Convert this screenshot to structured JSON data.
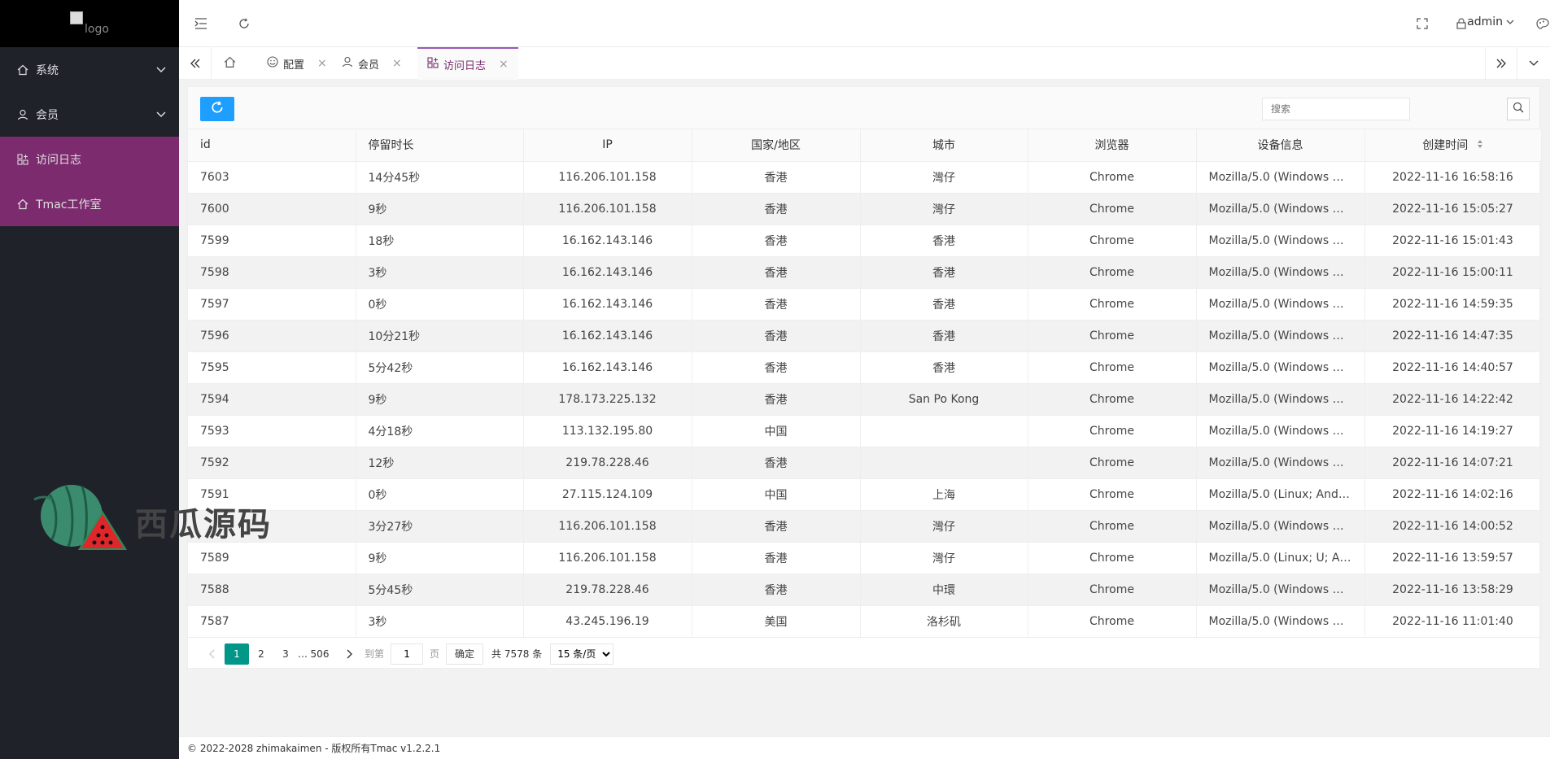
{
  "logo": {
    "alt": "logo"
  },
  "sidebar": {
    "items": [
      {
        "label": "系统",
        "icon": "home-icon",
        "has_children": true
      },
      {
        "label": "会员",
        "icon": "user-icon",
        "has_children": true
      },
      {
        "label": "访问日志",
        "icon": "apps-icon",
        "active": true
      },
      {
        "label": "Tmac工作室",
        "icon": "home-icon"
      }
    ]
  },
  "header": {
    "user": "admin"
  },
  "tabs": [
    {
      "label": "",
      "icon": "home-icon"
    },
    {
      "label": "配置",
      "icon": "smile-icon"
    },
    {
      "label": "会员",
      "icon": "user-icon"
    },
    {
      "label": "访问日志",
      "icon": "apps-icon",
      "active": true
    }
  ],
  "toolbar": {
    "search_placeholder": "搜索"
  },
  "table": {
    "columns": [
      "id",
      "停留时长",
      "IP",
      "国家/地区",
      "城市",
      "浏览器",
      "设备信息",
      "创建时间"
    ],
    "rows": [
      [
        "7603",
        "14分45秒",
        "116.206.101.158",
        "香港",
        "灣仔",
        "Chrome",
        "Mozilla/5.0 (Windows NT ...",
        "2022-11-16 16:58:16"
      ],
      [
        "7600",
        "9秒",
        "116.206.101.158",
        "香港",
        "灣仔",
        "Chrome",
        "Mozilla/5.0 (Windows NT ...",
        "2022-11-16 15:05:27"
      ],
      [
        "7599",
        "18秒",
        "16.162.143.146",
        "香港",
        "香港",
        "Chrome",
        "Mozilla/5.0 (Windows NT ...",
        "2022-11-16 15:01:43"
      ],
      [
        "7598",
        "3秒",
        "16.162.143.146",
        "香港",
        "香港",
        "Chrome",
        "Mozilla/5.0 (Windows NT ...",
        "2022-11-16 15:00:11"
      ],
      [
        "7597",
        "0秒",
        "16.162.143.146",
        "香港",
        "香港",
        "Chrome",
        "Mozilla/5.0 (Windows NT ...",
        "2022-11-16 14:59:35"
      ],
      [
        "7596",
        "10分21秒",
        "16.162.143.146",
        "香港",
        "香港",
        "Chrome",
        "Mozilla/5.0 (Windows NT ...",
        "2022-11-16 14:47:35"
      ],
      [
        "7595",
        "5分42秒",
        "16.162.143.146",
        "香港",
        "香港",
        "Chrome",
        "Mozilla/5.0 (Windows NT ...",
        "2022-11-16 14:40:57"
      ],
      [
        "7594",
        "9秒",
        "178.173.225.132",
        "香港",
        "San Po Kong",
        "Chrome",
        "Mozilla/5.0 (Windows NT ...",
        "2022-11-16 14:22:42"
      ],
      [
        "7593",
        "4分18秒",
        "113.132.195.80",
        "中国",
        "",
        "Chrome",
        "Mozilla/5.0 (Windows NT ...",
        "2022-11-16 14:19:27"
      ],
      [
        "7592",
        "12秒",
        "219.78.228.46",
        "香港",
        "",
        "Chrome",
        "Mozilla/5.0 (Windows NT ...",
        "2022-11-16 14:07:21"
      ],
      [
        "7591",
        "0秒",
        "27.115.124.109",
        "中国",
        "上海",
        "Chrome",
        "Mozilla/5.0 (Linux; Androi...",
        "2022-11-16 14:02:16"
      ],
      [
        "",
        "3分27秒",
        "116.206.101.158",
        "香港",
        "灣仔",
        "Chrome",
        "Mozilla/5.0 (Windows NT ...",
        "2022-11-16 14:00:52"
      ],
      [
        "7589",
        "9秒",
        "116.206.101.158",
        "香港",
        "灣仔",
        "Chrome",
        "Mozilla/5.0 (Linux; U; And...",
        "2022-11-16 13:59:57"
      ],
      [
        "7588",
        "5分45秒",
        "219.78.228.46",
        "香港",
        "中環",
        "Chrome",
        "Mozilla/5.0 (Windows NT ...",
        "2022-11-16 13:58:29"
      ],
      [
        "7587",
        "3秒",
        "43.245.196.19",
        "美国",
        "洛杉矶",
        "Chrome",
        "Mozilla/5.0 (Windows NT ...",
        "2022-11-16 11:01:40"
      ]
    ]
  },
  "pager": {
    "pages": [
      "1",
      "2",
      "3"
    ],
    "ellipsis": "…",
    "last": "506",
    "goto_label": "到第",
    "goto_value": "1",
    "page_unit": "页",
    "ok": "确定",
    "total": "共 7578 条",
    "per_page": "15 条/页"
  },
  "footer": {
    "text": "© 2022-2028 zhimakaimen - 版权所有Tmac v1.2.2.1"
  },
  "watermark": {
    "text": "西瓜源码"
  },
  "colors": {
    "sidebar_bg": "#20222a",
    "active_bg": "#7b2b6e",
    "primary": "#1e9fff",
    "pager_current": "#009688"
  }
}
